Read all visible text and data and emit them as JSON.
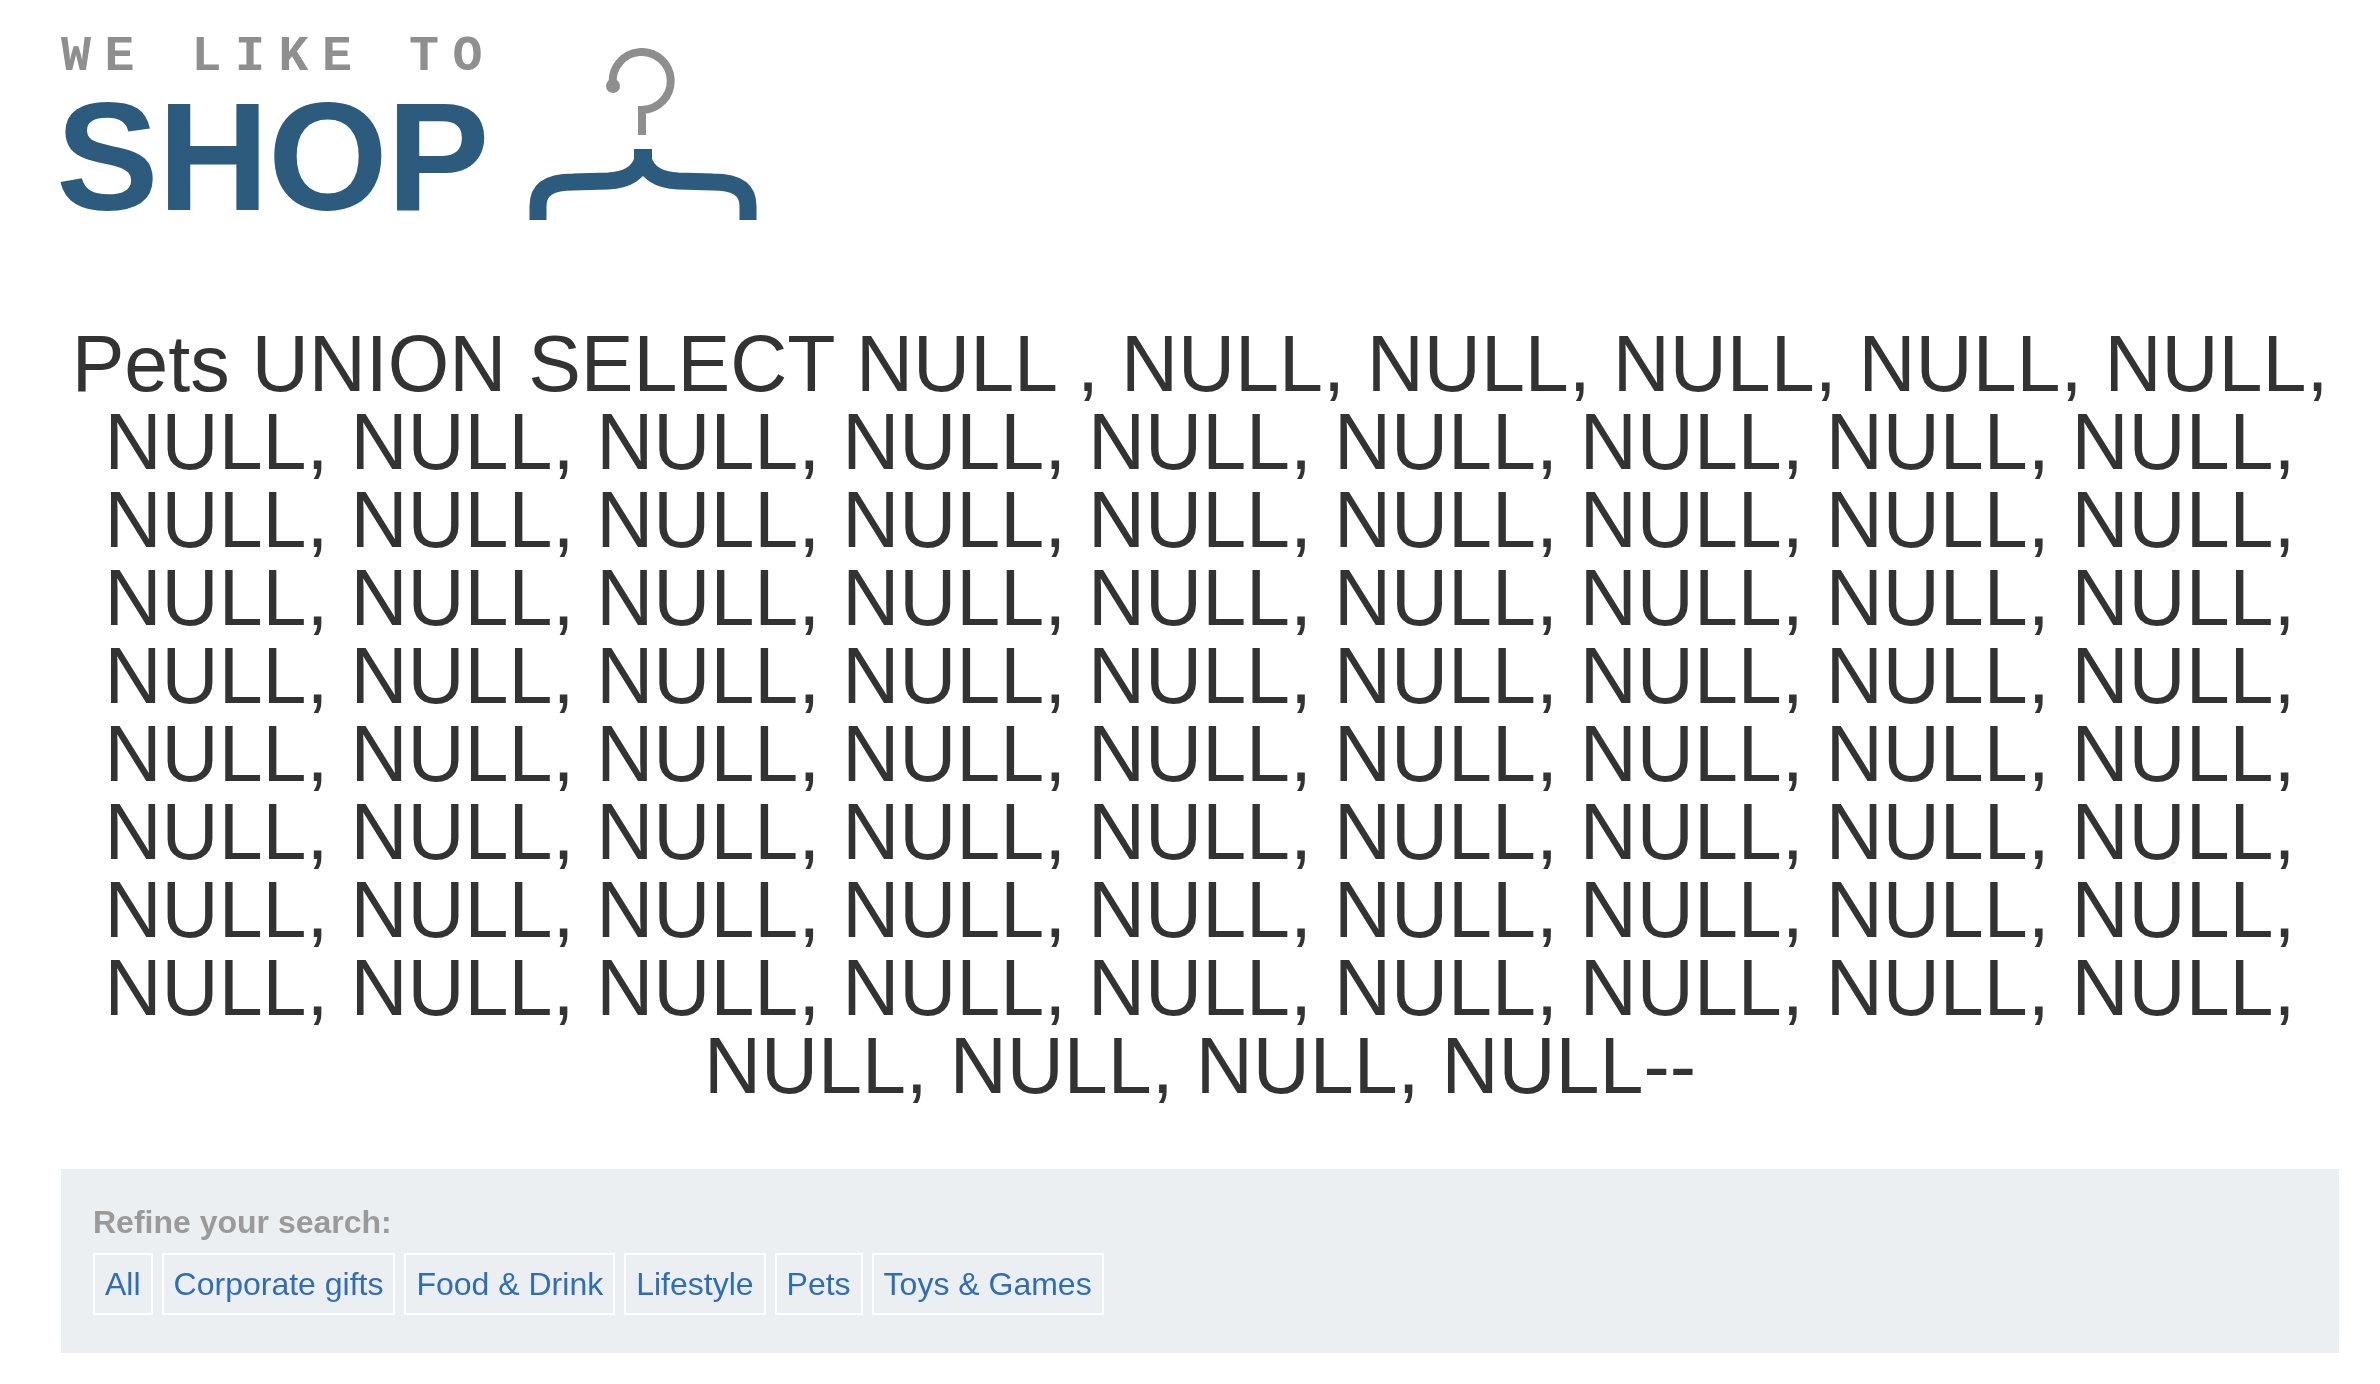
{
  "logo": {
    "tagline": "WE LIKE TO",
    "wordmark": "SHOP"
  },
  "heading": "Pets UNION SELECT NULL , NULL, NULL, NULL, NULL, NULL, NULL, NULL, NULL, NULL, NULL, NULL, NULL, NULL, NULL, NULL, NULL, NULL, NULL, NULL, NULL, NULL, NULL, NULL, NULL, NULL, NULL, NULL, NULL, NULL, NULL, NULL, NULL, NULL, NULL, NULL, NULL, NULL, NULL, NULL, NULL, NULL, NULL, NULL, NULL, NULL, NULL, NULL, NULL, NULL, NULL, NULL, NULL, NULL, NULL, NULL, NULL, NULL, NULL, NULL, NULL, NULL, NULL, NULL, NULL, NULL, NULL, NULL, NULL, NULL, NULL, NULL, NULL, NULL, NULL, NULL, NULL, NULL, NULL, NULL, NULL, NULL--",
  "refine": {
    "label": "Refine your search:",
    "filters": [
      "All",
      "Corporate gifts",
      "Food & Drink",
      "Lifestyle",
      "Pets",
      "Toys & Games"
    ]
  }
}
